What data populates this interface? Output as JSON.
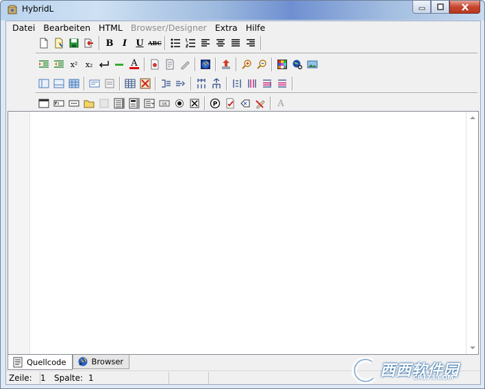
{
  "window": {
    "title": "HybridL",
    "buttons": {
      "minimize": "minimize-icon",
      "maximize": "maximize-icon",
      "close": "close-icon"
    }
  },
  "menubar": {
    "items": [
      {
        "label": "Datei",
        "enabled": true
      },
      {
        "label": "Bearbeiten",
        "enabled": true
      },
      {
        "label": "HTML",
        "enabled": true
      },
      {
        "label": "Browser/Designer",
        "enabled": false
      },
      {
        "label": "Extra",
        "enabled": true
      },
      {
        "label": "Hilfe",
        "enabled": true
      }
    ]
  },
  "toolbars": {
    "row1": {
      "bold": "B",
      "italic": "I",
      "underline": "U",
      "strike": "ABC"
    },
    "row2": {
      "superscript": "x²",
      "subscript": "x₂",
      "font_color_letter": "A"
    },
    "row4": {
      "form_text_letter": "A"
    }
  },
  "tabs": [
    {
      "label": "Quellcode",
      "icon": "source-code-icon",
      "active": true
    },
    {
      "label": "Browser",
      "icon": "globe-icon",
      "active": false
    }
  ],
  "statusbar": {
    "line_label": "Zeile:",
    "line_value": "1",
    "col_label": "Spalte:",
    "col_value": "1"
  },
  "watermark": {
    "main": "西西软件园",
    "sub": "CR173.COM"
  },
  "colors": {
    "accent": "#1f4e9a",
    "close_button": "#c7462f",
    "editor_bg": "#ffffff"
  }
}
